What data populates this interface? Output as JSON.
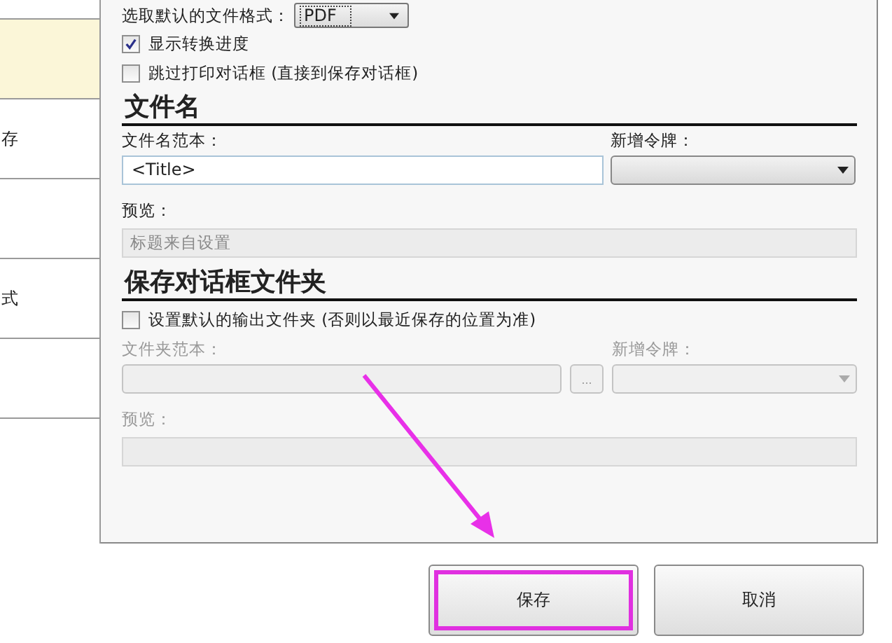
{
  "sidebar": {
    "items": [
      {
        "selected": true
      },
      {
        "label": "存",
        "selected": false
      },
      {
        "selected": false
      },
      {
        "label": "式",
        "selected": false
      },
      {
        "selected": false
      }
    ]
  },
  "format": {
    "label": "选取默认的文件格式：",
    "value": "PDF"
  },
  "options": [
    {
      "label": "显示转换进度",
      "checked": true
    },
    {
      "label": "跳过打印对话框 (直接到保存对话框)",
      "checked": false
    }
  ],
  "filename": {
    "heading": "文件名",
    "disabled": false,
    "template_label": "文件名范本：",
    "template_value": "<Title>",
    "token_label": "新增令牌：",
    "preview_label": "预览：",
    "preview_value": "标题来自设置"
  },
  "folder": {
    "heading": "保存对话框文件夹",
    "option": {
      "label": "设置默认的输出文件夹 (否则以最近保存的位置为准)",
      "checked": false
    },
    "disabled": true,
    "template_label": "文件夹范本：",
    "browse": "...",
    "token_label": "新增令牌：",
    "preview_label": "预览："
  },
  "buttons": [
    {
      "label": "保存",
      "highlighted": true
    },
    {
      "label": "取消",
      "highlighted": false
    }
  ]
}
